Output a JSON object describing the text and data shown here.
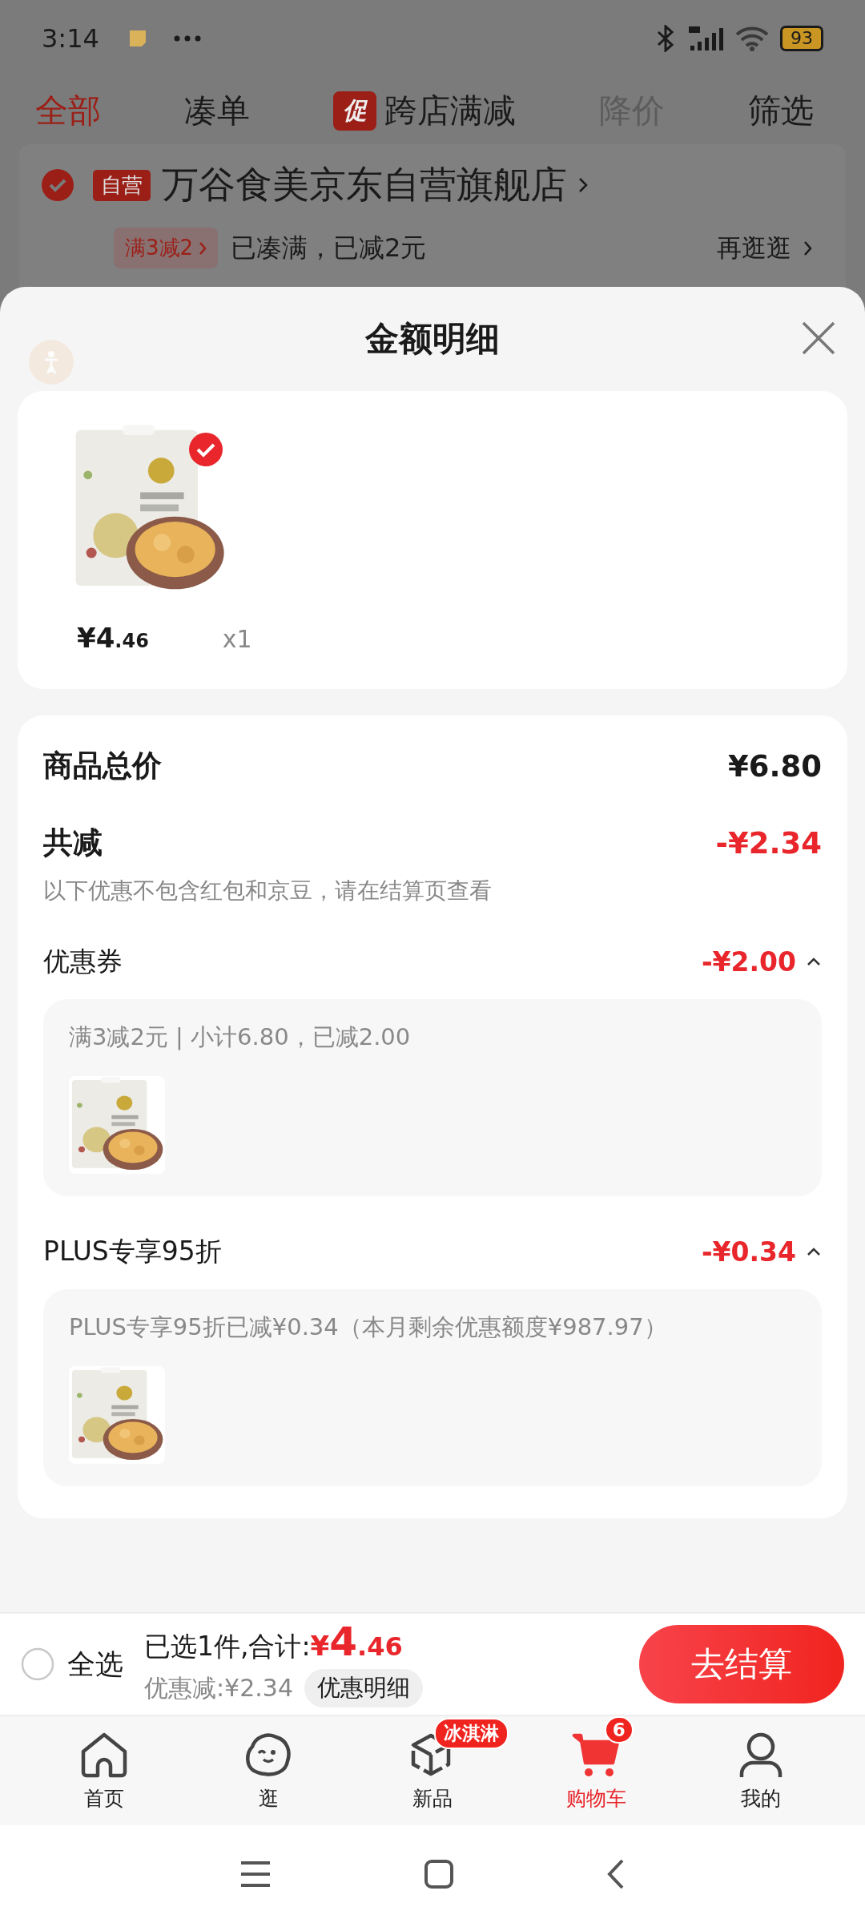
{
  "status_bar": {
    "time": "3:14",
    "battery": "93"
  },
  "tabs": [
    {
      "label": "全部",
      "selected": true,
      "disabled": false
    },
    {
      "label": "凑单",
      "selected": false,
      "disabled": false
    },
    {
      "label": "跨店满减",
      "badge": "促",
      "selected": false,
      "disabled": false
    },
    {
      "label": "降价",
      "selected": false,
      "disabled": true
    },
    {
      "label": "筛选",
      "selected": false,
      "disabled": false
    }
  ],
  "store": {
    "checked": true,
    "tag": "自营",
    "name": "万谷食美京东自营旗舰店",
    "promo_tag": "满3减2",
    "promo_text": "已凑满，已减2元",
    "link": "再逛逛"
  },
  "sheet": {
    "title": "金额明细",
    "product": {
      "checked": true,
      "price": {
        "integer": "¥4",
        "decimal": ".46"
      },
      "quantity": "x1"
    },
    "total_label": "商品总价",
    "total": "¥6.80",
    "reduce_label": "共减",
    "reduce": "-¥2.34",
    "note": "以下优惠不包含红包和京豆，请在结算页查看",
    "groups": [
      {
        "label": "优惠券",
        "amount": "-¥2.00",
        "expanded": true,
        "detail": "满3减2元 | 小计6.80，已减2.00"
      },
      {
        "label": "PLUS专享95折",
        "amount": "-¥0.34",
        "expanded": true,
        "detail": "PLUS专享95折已减¥0.34（本月剩余优惠额度¥987.97）"
      }
    ]
  },
  "checkout": {
    "select_all": {
      "label": "全选",
      "checked": false
    },
    "selected_text": "已选1件,合计:",
    "total": {
      "integer": "¥4",
      "decimal": ".46"
    },
    "savings": "优惠减:¥2.34",
    "detail_button": "优惠明细",
    "checkout_button": "去结算"
  },
  "bottom_nav": [
    {
      "label": "首页",
      "selected": false
    },
    {
      "label": "逛",
      "selected": false
    },
    {
      "label": "新品",
      "badge": "冰淇淋",
      "selected": false
    },
    {
      "label": "购物车",
      "badge": "6",
      "selected": true
    },
    {
      "label": "我的",
      "selected": false
    }
  ]
}
